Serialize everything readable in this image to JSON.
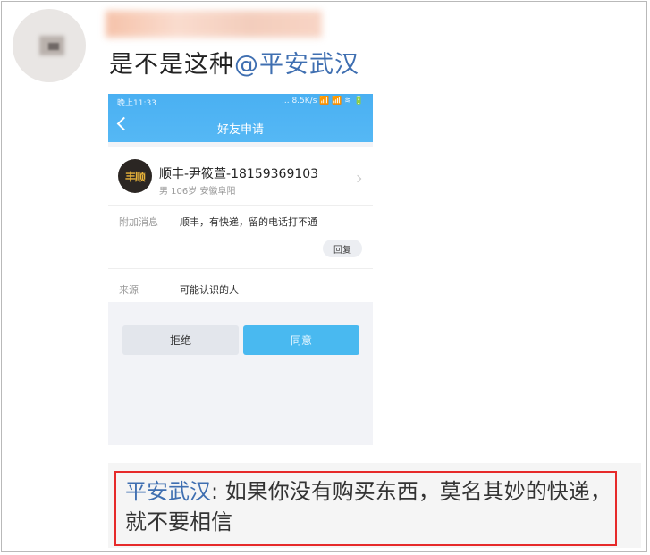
{
  "post": {
    "text": "是不是这种",
    "mention": "@平安武汉"
  },
  "phone": {
    "status_time": "晚上11:33",
    "status_icons": "... 8.5K/s 📶 📶 ≋ 🔋",
    "title": "好友申请",
    "contact": {
      "logo_text": "丰顺",
      "name": "顺丰-尹筱萱-18159369103",
      "meta": "男  106岁  安徽阜阳"
    },
    "extra": {
      "label": "附加消息",
      "value": "顺丰，有快递，留的电话打不通",
      "reply_button": "回复"
    },
    "source": {
      "label": "来源",
      "value": "可能认识的人"
    },
    "reject_button": "拒绝",
    "accept_button": "同意"
  },
  "reply": {
    "author": "平安武汉",
    "text": ": 如果你没有购买东西，莫名其妙的快递，就不要相信"
  },
  "colors": {
    "mention": "#3f6fb1",
    "phone_header": "#4ab0f2",
    "accept": "#49b9f0",
    "highlight": "#e62a2a"
  }
}
